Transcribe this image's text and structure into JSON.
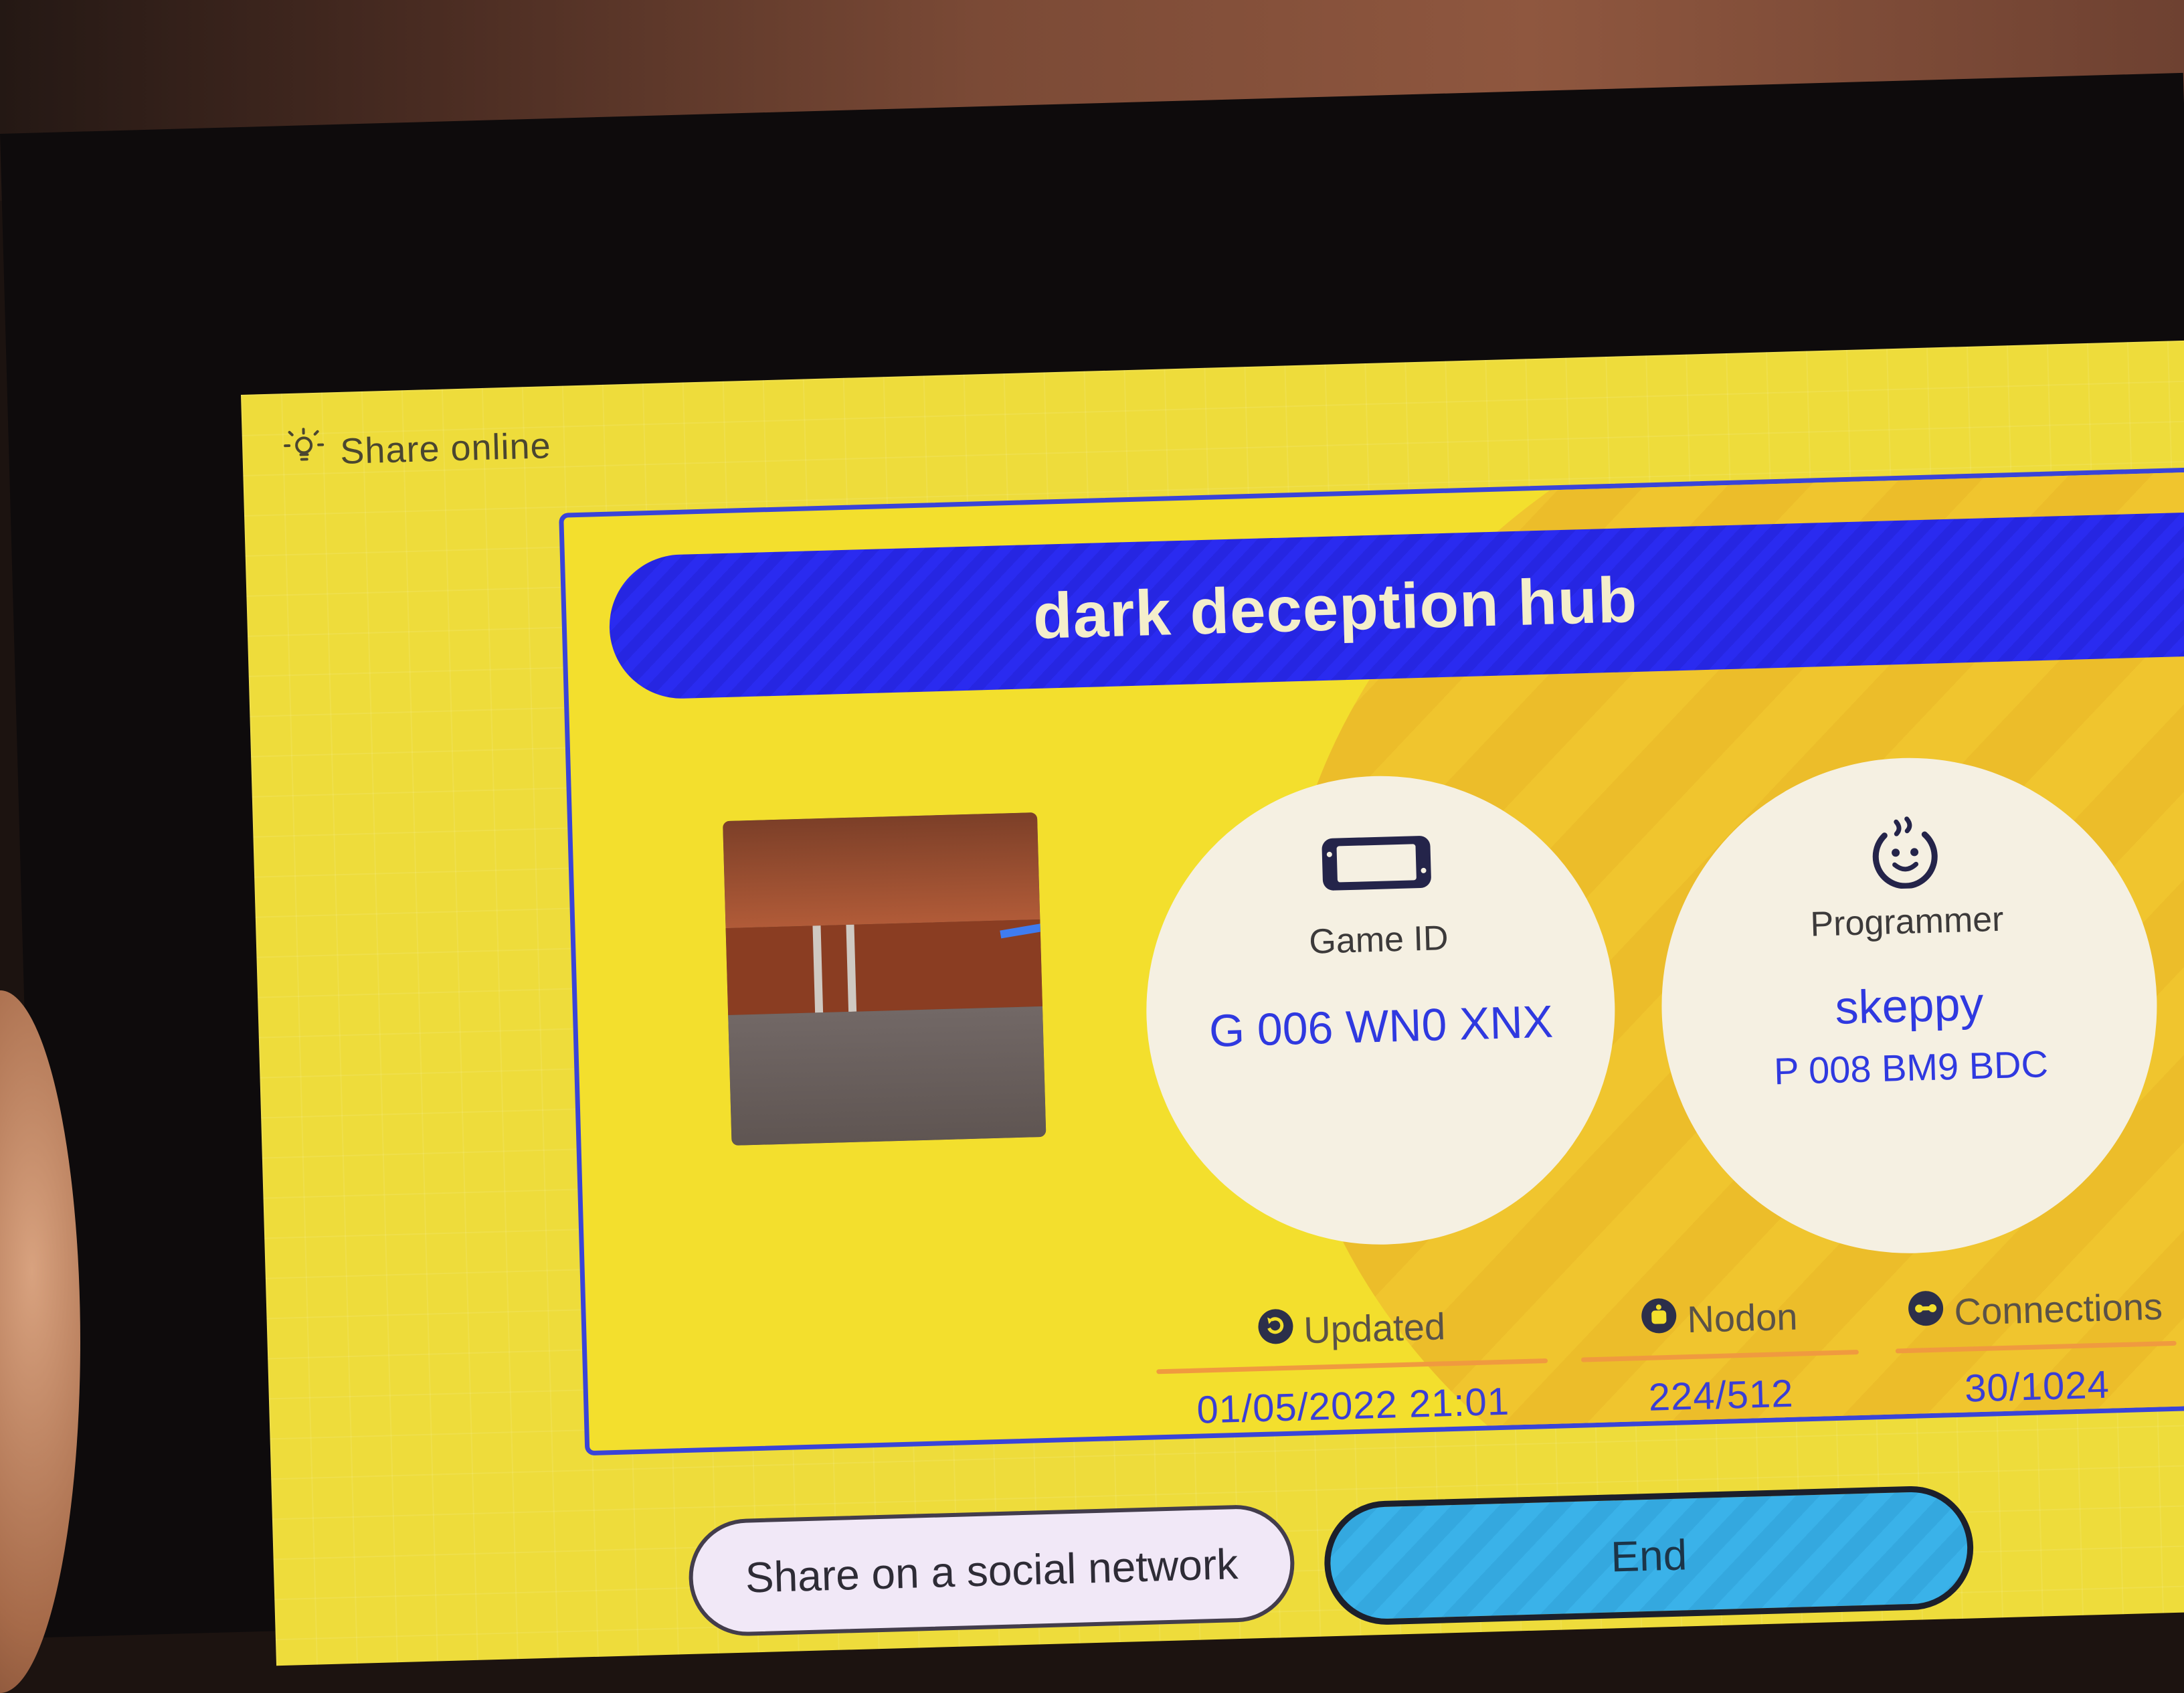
{
  "screen": {
    "header": {
      "label": "Share online",
      "icon": "lightbulb-icon"
    },
    "card": {
      "title": "dark deception hub",
      "game_id": {
        "icon": "console-icon",
        "label": "Game ID",
        "value": "G 006 WN0 XNX"
      },
      "programmer": {
        "icon": "smiley-face-icon",
        "label": "Programmer",
        "name": "skeppy",
        "id": "P 008 BM9 BDC"
      },
      "stats": [
        {
          "icon": "refresh-icon",
          "label": "Updated",
          "value": "01/05/2022 21:01"
        },
        {
          "icon": "nodon-icon",
          "label": "Nodon",
          "value": "224/512"
        },
        {
          "icon": "link-icon",
          "label": "Connections",
          "value": "30/1024"
        }
      ]
    },
    "buttons": {
      "share": "Share on a social network",
      "end": "End"
    },
    "colors": {
      "background": "#eedc3b",
      "title_bar": "#2a2bf0",
      "accent_text": "#2f39e0",
      "end_button": "#3ab2e9"
    }
  }
}
